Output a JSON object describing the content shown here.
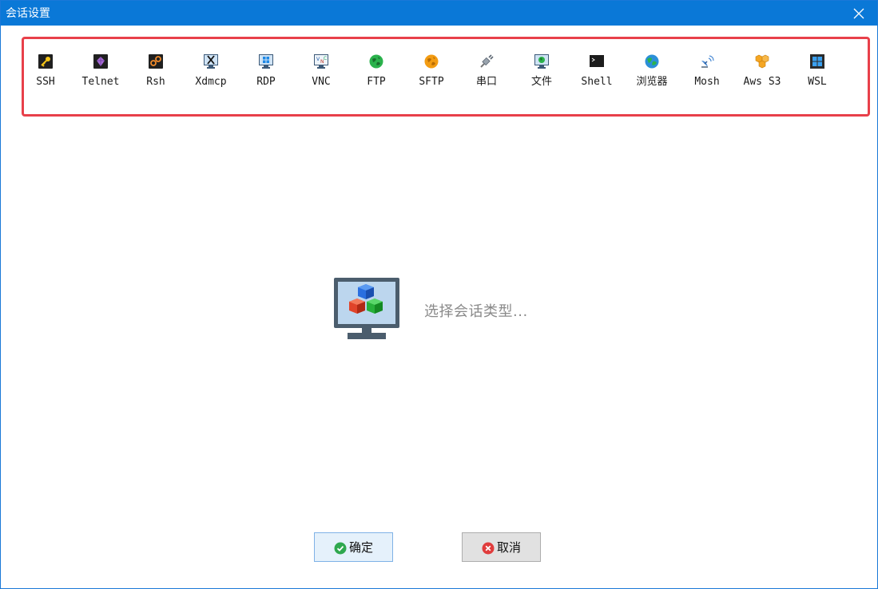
{
  "window": {
    "title": "会话设置"
  },
  "session_types": [
    {
      "label": "SSH",
      "icon": "key-icon"
    },
    {
      "label": "Telnet",
      "icon": "telnet-icon"
    },
    {
      "label": "Rsh",
      "icon": "rsh-icon"
    },
    {
      "label": "Xdmcp",
      "icon": "x-display-icon"
    },
    {
      "label": "RDP",
      "icon": "windows-monitor-icon"
    },
    {
      "label": "VNC",
      "icon": "vnc-icon"
    },
    {
      "label": "FTP",
      "icon": "green-globe-icon"
    },
    {
      "label": "SFTP",
      "icon": "orange-globe-icon"
    },
    {
      "label": "串口",
      "icon": "serial-plug-icon"
    },
    {
      "label": "文件",
      "icon": "file-monitor-icon"
    },
    {
      "label": "Shell",
      "icon": "terminal-icon"
    },
    {
      "label": "浏览器",
      "icon": "browser-globe-icon"
    },
    {
      "label": "Mosh",
      "icon": "satellite-icon"
    },
    {
      "label": "Aws S3",
      "icon": "aws-cubes-icon"
    },
    {
      "label": "WSL",
      "icon": "windows-logo-icon"
    }
  ],
  "placeholder": {
    "text": "选择会话类型..."
  },
  "buttons": {
    "ok_label": "确定",
    "cancel_label": "取消"
  },
  "colors": {
    "titlebar": "#0a78d7",
    "highlight_border": "#e8404a",
    "ok_icon": "#2fa84f",
    "cancel_icon": "#e03c3c"
  }
}
